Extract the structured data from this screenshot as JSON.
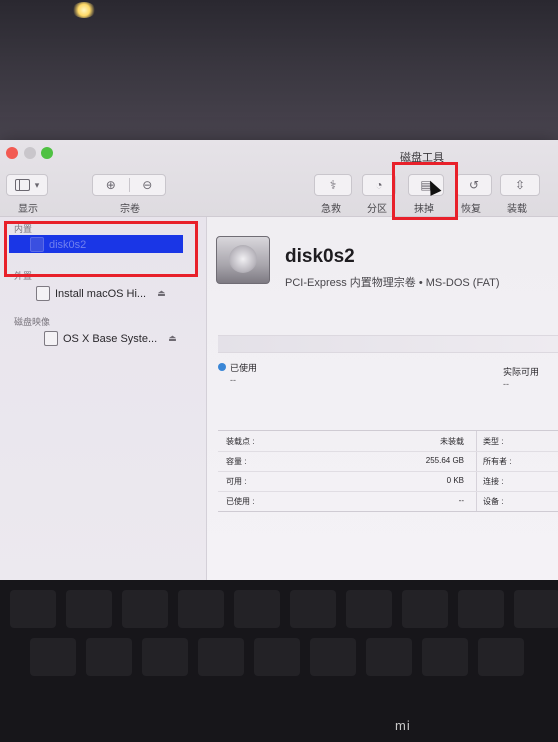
{
  "window": {
    "title": "磁盘工具"
  },
  "toolbar": {
    "view_label": "显示",
    "volume_label": "宗卷",
    "first_aid_label": "急救",
    "partition_label": "分区",
    "erase_label": "抹掉",
    "restore_label": "恢复",
    "mount_label": "装载"
  },
  "sidebar": {
    "section_internal": "内置",
    "section_external": "外置",
    "section_images": "磁盘映像",
    "items": [
      {
        "label": "disk0s2"
      },
      {
        "label": "Install macOS Hi..."
      },
      {
        "label": "OS X Base Syste..."
      }
    ]
  },
  "main": {
    "disk_name": "disk0s2",
    "disk_subtitle": "PCI-Express 内置物理宗卷 • MS-DOS (FAT)",
    "used_label": "已使用",
    "used_value": "--",
    "available_label": "实际可用",
    "available_value": "--",
    "info": [
      {
        "key": "装载点 :",
        "value": "未装载",
        "key2": "类型 :"
      },
      {
        "key": "容量 :",
        "value": "255.64 GB",
        "key2": "所有者 :"
      },
      {
        "key": "可用 :",
        "value": "0 KB",
        "key2": "连接 :"
      },
      {
        "key": "已使用 :",
        "value": "--",
        "key2": "设备 :"
      }
    ]
  },
  "keyboard": {
    "brand": "mi"
  },
  "colors": {
    "selection": "#1a36e6",
    "annotation": "#e8202a"
  }
}
